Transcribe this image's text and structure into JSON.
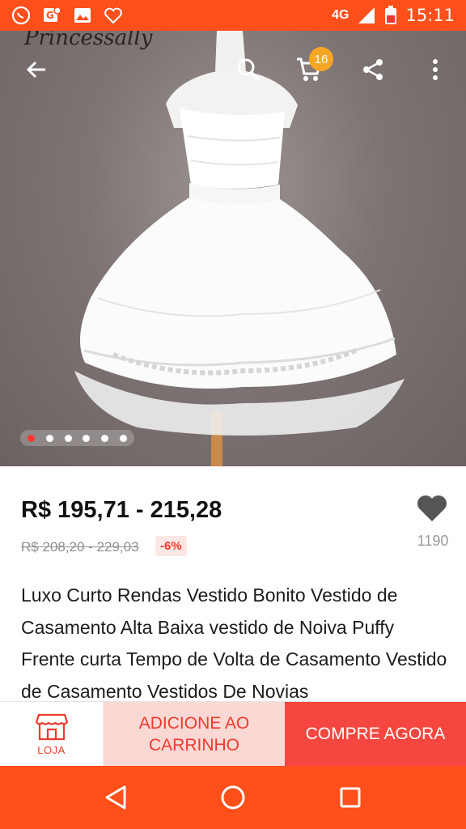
{
  "status_bar": {
    "time": "15:11",
    "network": "4G",
    "left_icons": [
      "whatsapp-icon",
      "maps-notification-icon",
      "gallery-icon",
      "heart-outline-icon"
    ],
    "right_icons": [
      "signal-icon",
      "battery-icon"
    ]
  },
  "hero": {
    "watermark": "Princessally",
    "cart_count": "16",
    "image_count": 6,
    "active_image_index": 0,
    "toolbar_icons": [
      "back-arrow-icon",
      "search-icon",
      "cart-icon",
      "share-icon",
      "more-vert-icon"
    ]
  },
  "product": {
    "price": "R$ 195,71 - 215,28",
    "original_price": "R$ 208,20 - 229,03",
    "discount": "-6%",
    "wishlist_count": "1190",
    "title": "Luxo Curto Rendas Vestido Bonito Vestido de Casamento Alta Baixa vestido de Noiva Puffy Frente curta Tempo de Volta de Casamento Vestido de Casamento Vestidos De Novias"
  },
  "actions": {
    "store_label": "LOJA",
    "add_to_cart": "ADICIONE AO CARRINHO",
    "buy_now": "COMPRE AGORA"
  },
  "nav": {
    "icons": [
      "back-triangle-icon",
      "home-circle-icon",
      "recents-square-icon"
    ]
  },
  "colors": {
    "brand": "#ff4f1a",
    "accent_red": "#ef3a2c",
    "cart_badge": "#f5a623",
    "buy_button": "#f5473f",
    "cart_button": "#fcd8d4"
  }
}
